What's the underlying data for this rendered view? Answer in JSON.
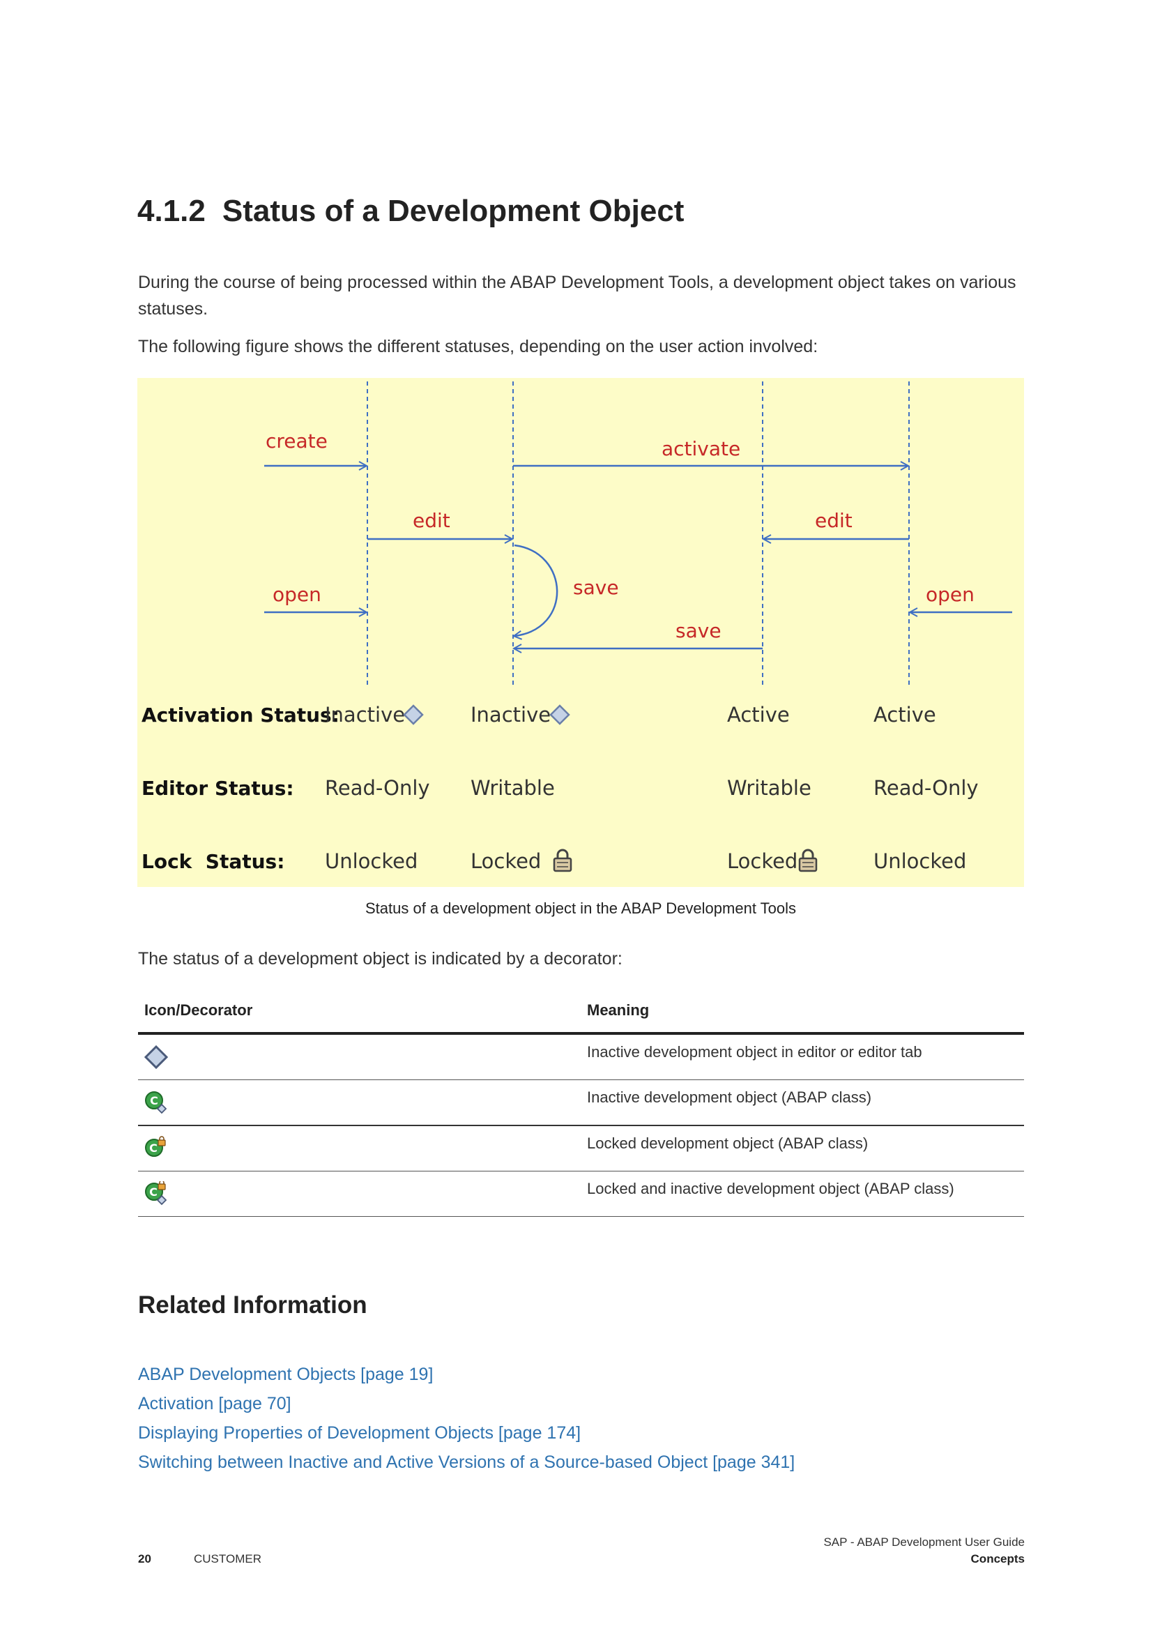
{
  "heading": {
    "number": "4.1.2",
    "title": "Status of a Development Object"
  },
  "intro": "During the course of being processed within the ABAP Development Tools, a development object takes on various statuses.",
  "figure_intro": "The following figure shows the different statuses, depending on the user action involved:",
  "figure": {
    "actions": {
      "create": "create",
      "activate": "activate",
      "edit_1": "edit",
      "edit_2": "edit",
      "open_1": "open",
      "open_2": "open",
      "save_1": "save",
      "save_2": "save"
    },
    "rows": [
      {
        "label": "Activation Status:",
        "values": [
          "Inactive",
          "Inactive",
          "Active",
          "Active"
        ]
      },
      {
        "label": "Editor Status:",
        "values": [
          "Read-Only",
          "Writable",
          "Writable",
          "Read-Only"
        ]
      },
      {
        "label": "Lock  Status:",
        "values": [
          "Unlocked",
          "Locked",
          "Locked",
          "Unlocked"
        ]
      }
    ],
    "colors": {
      "background": "#fdfcc8",
      "arrows": "#3f6fc3",
      "action_text": "#c62828"
    }
  },
  "caption": "Status of a development object in the ABAP Development Tools",
  "decorator_intro": "The status of a development object is indicated by a decorator:",
  "table": {
    "headers": [
      "Icon/Decorator",
      "Meaning"
    ],
    "rows": [
      {
        "icon": "inactive-diamond-icon",
        "meaning": "Inactive development object in editor or editor tab"
      },
      {
        "icon": "abap-class-inactive-icon",
        "meaning": "Inactive development object (ABAP class)"
      },
      {
        "icon": "abap-class-locked-icon",
        "meaning": "Locked development object (ABAP class)"
      },
      {
        "icon": "abap-class-locked-inactive-icon",
        "meaning": "Locked and inactive development object (ABAP class)"
      }
    ]
  },
  "related": {
    "title": "Related Information",
    "links": [
      "ABAP Development Objects [page 19]",
      "Activation [page 70]",
      "Displaying Properties of Development Objects [page 174]",
      "Switching between Inactive and Active Versions of a Source-based Object [page 341]"
    ]
  },
  "footer": {
    "page_number": "20",
    "classification": "CUSTOMER",
    "doc_title": "SAP - ABAP Development User Guide",
    "section": "Concepts"
  }
}
